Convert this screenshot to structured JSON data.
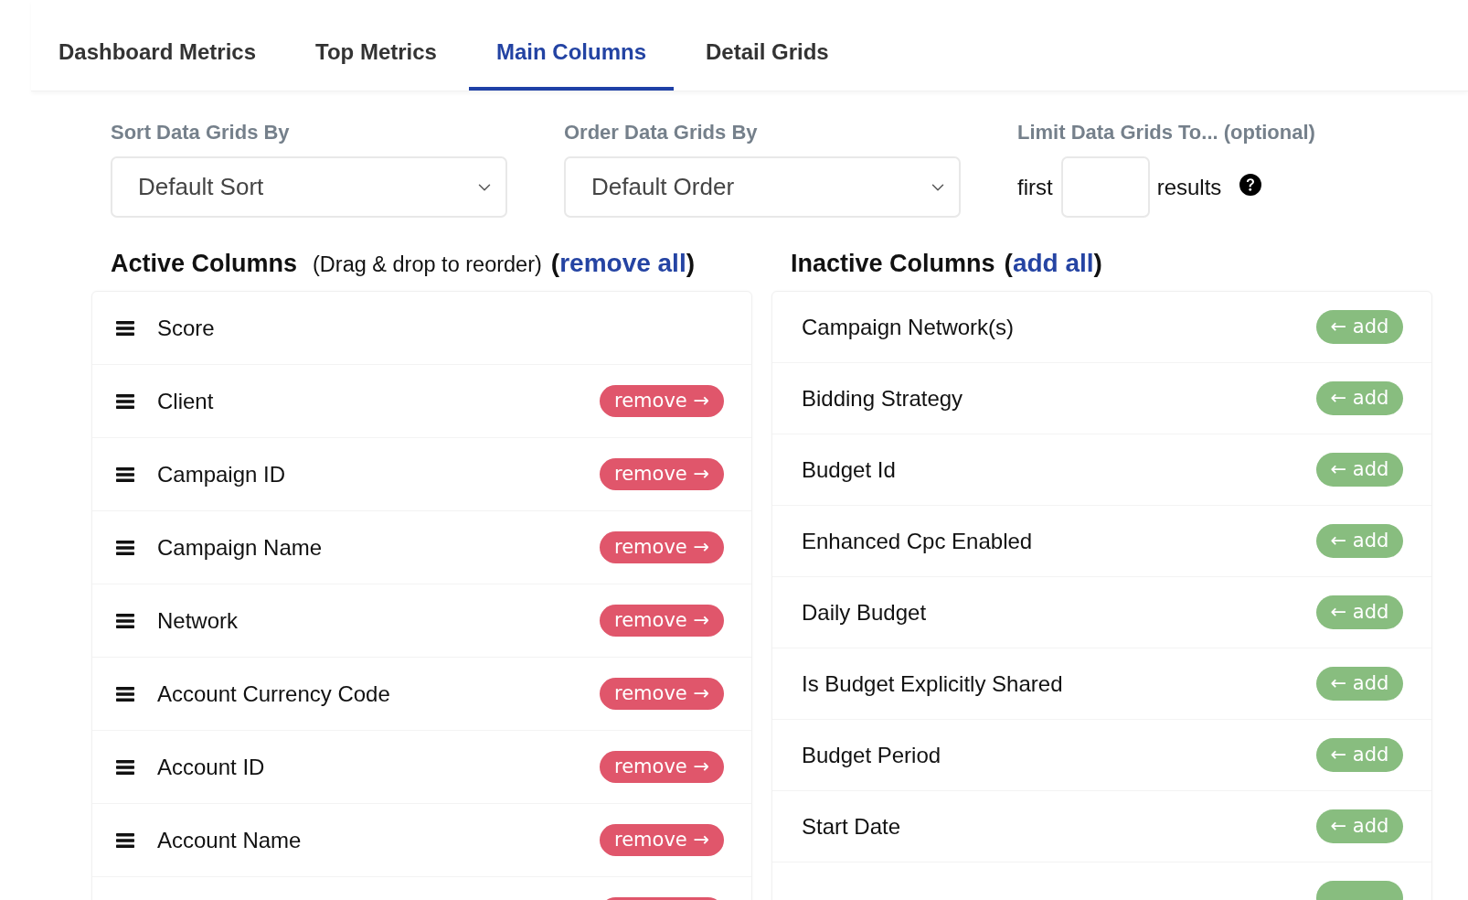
{
  "tabs": [
    {
      "label": "Dashboard Metrics",
      "selected": false
    },
    {
      "label": "Top Metrics",
      "selected": false
    },
    {
      "label": "Main Columns",
      "selected": true
    },
    {
      "label": "Detail Grids",
      "selected": false
    }
  ],
  "filters": [
    {
      "kind": "select",
      "label": "Sort Data Grids By",
      "value": "Default Sort"
    },
    {
      "kind": "select",
      "label": "Order Data Grids By",
      "value": "Default Order"
    },
    {
      "kind": "limit",
      "label": "Limit Data Grids To... (optional)",
      "prefix": "first",
      "suffix": "results"
    }
  ],
  "active_columns": {
    "title": "Active Columns",
    "hint": "(Drag & drop to reorder)",
    "action": {
      "before": "(",
      "link": "remove all",
      "after": ")"
    },
    "items": [
      {
        "kind": "fixed",
        "name": "Score"
      },
      {
        "kind": "removable",
        "name": "Client",
        "button": "remove →"
      },
      {
        "kind": "removable",
        "name": "Campaign ID",
        "button": "remove →"
      },
      {
        "kind": "removable",
        "name": "Campaign Name",
        "button": "remove →"
      },
      {
        "kind": "removable",
        "name": "Network",
        "button": "remove →"
      },
      {
        "kind": "removable",
        "name": "Account Currency Code",
        "button": "remove →"
      },
      {
        "kind": "removable",
        "name": "Account ID",
        "button": "remove →"
      },
      {
        "kind": "removable",
        "name": "Account Name",
        "button": "remove →"
      },
      {
        "kind": "clipped"
      }
    ]
  },
  "inactive_columns": {
    "title": "Inactive Columns",
    "action": {
      "before": "(",
      "link": "add all",
      "after": ")"
    },
    "items": [
      {
        "kind": "addable",
        "name": "Campaign Network(s)",
        "button": "← add"
      },
      {
        "kind": "addable",
        "name": "Bidding Strategy",
        "button": "← add"
      },
      {
        "kind": "addable",
        "name": "Budget Id",
        "button": "← add"
      },
      {
        "kind": "addable",
        "name": "Enhanced Cpc Enabled",
        "button": "← add"
      },
      {
        "kind": "addable",
        "name": "Daily Budget",
        "button": "← add"
      },
      {
        "kind": "addable",
        "name": "Is Budget Explicitly Shared",
        "button": "← add"
      },
      {
        "kind": "addable",
        "name": "Budget Period",
        "button": "← add"
      },
      {
        "kind": "addable",
        "name": "Start Date",
        "button": "← add"
      },
      {
        "kind": "clipped"
      }
    ]
  }
}
